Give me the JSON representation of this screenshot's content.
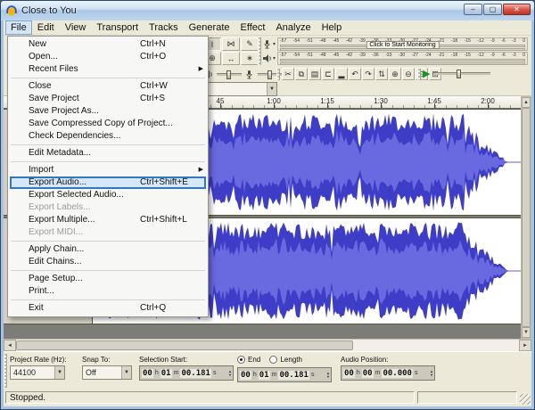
{
  "window": {
    "title": "Close to You",
    "minimize_glyph": "–",
    "maximize_glyph": "▢",
    "close_glyph": "✕"
  },
  "colors": {
    "waveform_peak": "#3d3dc8",
    "waveform_rms": "#6a6ae0",
    "menu_highlight_border": "#2f78c8",
    "menu_highlight_fill": "#d5e7f9"
  },
  "menu_bar": {
    "items": [
      {
        "label": "File",
        "active": true
      },
      {
        "label": "Edit"
      },
      {
        "label": "View"
      },
      {
        "label": "Transport"
      },
      {
        "label": "Tracks"
      },
      {
        "label": "Generate"
      },
      {
        "label": "Effect"
      },
      {
        "label": "Analyze"
      },
      {
        "label": "Help"
      }
    ]
  },
  "file_menu": {
    "items": [
      {
        "label": "New",
        "shortcut": "Ctrl+N"
      },
      {
        "label": "Open...",
        "shortcut": "Ctrl+O"
      },
      {
        "label": "Recent Files",
        "submenu": true
      },
      {
        "type": "separator"
      },
      {
        "label": "Close",
        "shortcut": "Ctrl+W"
      },
      {
        "label": "Save Project",
        "shortcut": "Ctrl+S"
      },
      {
        "label": "Save Project As..."
      },
      {
        "label": "Save Compressed Copy of Project..."
      },
      {
        "label": "Check Dependencies..."
      },
      {
        "type": "separator"
      },
      {
        "label": "Edit Metadata..."
      },
      {
        "type": "separator"
      },
      {
        "label": "Import",
        "submenu": true
      },
      {
        "label": "Export Audio...",
        "shortcut": "Ctrl+Shift+E",
        "highlighted": true
      },
      {
        "label": "Export Selected Audio..."
      },
      {
        "label": "Export Labels...",
        "disabled": true
      },
      {
        "label": "Export Multiple...",
        "shortcut": "Ctrl+Shift+L"
      },
      {
        "label": "Export MIDI...",
        "disabled": true
      },
      {
        "type": "separator"
      },
      {
        "label": "Apply Chain..."
      },
      {
        "label": "Edit Chains..."
      },
      {
        "type": "separator"
      },
      {
        "label": "Page Setup..."
      },
      {
        "label": "Print..."
      },
      {
        "type": "separator"
      },
      {
        "label": "Exit",
        "shortcut": "Ctrl+Q"
      }
    ]
  },
  "toolbars": {
    "tools": [
      {
        "name": "selection-tool",
        "glyph": "I",
        "pressed": true
      },
      {
        "name": "envelope-tool",
        "glyph": "⋈"
      },
      {
        "name": "draw-tool",
        "glyph": "✎"
      },
      {
        "name": "zoom-tool",
        "glyph": "⊕"
      },
      {
        "name": "timeshift-tool",
        "glyph": "↔"
      },
      {
        "name": "multi-tool",
        "glyph": "∗"
      }
    ],
    "edit": [
      {
        "name": "cut",
        "glyph": "✂"
      },
      {
        "name": "copy",
        "glyph": "⧉"
      },
      {
        "name": "paste",
        "glyph": "▤"
      },
      {
        "name": "trim",
        "glyph": "⊏"
      },
      {
        "name": "silence",
        "glyph": "▂"
      },
      {
        "name": "undo",
        "glyph": "↶"
      },
      {
        "name": "redo",
        "glyph": "↷"
      },
      {
        "name": "sync-lock",
        "glyph": "⇅"
      },
      {
        "name": "zoom-in",
        "glyph": "⊕"
      },
      {
        "name": "zoom-out",
        "glyph": "⊖"
      },
      {
        "name": "fit-selection",
        "glyph": "⊡"
      },
      {
        "name": "fit-project",
        "glyph": "⊞"
      }
    ],
    "meter_monitor_text": "Click to Start Monitoring",
    "meter_scale": [
      "-57",
      "-54",
      "-51",
      "-48",
      "-45",
      "-42",
      "-39",
      "-36",
      "-33",
      "-30",
      "-27",
      "-24",
      "-21",
      "-18",
      "-15",
      "-12",
      "-9",
      "-6",
      "-3",
      "0"
    ]
  },
  "device_toolbar": {
    "output_value": ""
  },
  "timeline": {
    "labels": [
      "45",
      "1:00",
      "1:15",
      "1:30",
      "1:45",
      "2:00"
    ]
  },
  "selection_toolbar": {
    "project_rate_label": "Project Rate (Hz):",
    "project_rate_value": "44100",
    "snap_label": "Snap To:",
    "snap_value": "Off",
    "selection_start_label": "Selection Start:",
    "end_radio_label": "End",
    "length_radio_label": "Length",
    "audio_position_label": "Audio Position:",
    "selection_start_value": "00 h 01 m 00.181 s",
    "selection_end_value": "00 h 01 m 00.181 s",
    "audio_position_value": "00 h 00 m 00.000 s"
  },
  "status_bar": {
    "text": "Stopped."
  }
}
